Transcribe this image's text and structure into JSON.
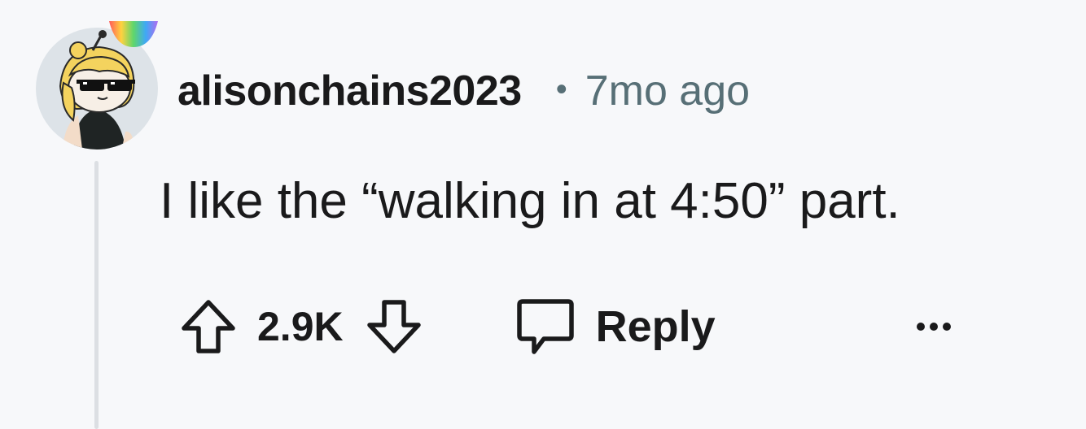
{
  "comment": {
    "author": "alisonchains2023",
    "separator": "•",
    "timestamp": "7mo ago",
    "text": "I like the “walking in at 4:50” part."
  },
  "actions": {
    "vote_count": "2.9K",
    "reply_label": "Reply",
    "upvote_icon": "upvote-arrow-icon",
    "downvote_icon": "downvote-arrow-icon",
    "reply_icon": "comment-bubble-icon",
    "more_icon": "more-options-icon"
  },
  "colors": {
    "background": "#f7f8fa",
    "text": "#1a1a1b",
    "meta": "#576f76",
    "thread_line": "#dcdfe3"
  }
}
